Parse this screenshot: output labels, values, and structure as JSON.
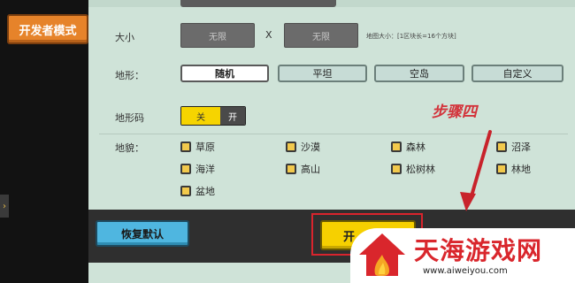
{
  "sidebar": {
    "dev_mode_label": "开发者模式",
    "expand_icon": "chevron-right-icon"
  },
  "form": {
    "size": {
      "label": "大小",
      "width_value": "无限",
      "x_label": "X",
      "height_value": "无限",
      "hint": "地图大小：[1区块长=16个方块]"
    },
    "terrain": {
      "label": "地形：",
      "options": [
        "随机",
        "平坦",
        "空岛",
        "自定义"
      ],
      "selected": "随机"
    },
    "terrain_code": {
      "label": "地形码",
      "off_label": "关",
      "on_label": "开",
      "selected": "关"
    },
    "biomes": {
      "label": "地貌：",
      "items": [
        "草原",
        "沙漠",
        "森林",
        "沼泽",
        "海洋",
        "高山",
        "松树林",
        "林地",
        "盆地"
      ]
    }
  },
  "footer": {
    "reset_label": "恢复默认",
    "start_label": "开"
  },
  "annotation": {
    "step_label": "步骤四",
    "color": "#d3323a"
  },
  "watermark": {
    "title": "天海游戏网",
    "url": "www.aiweiyou.com"
  },
  "colors": {
    "panel_bg": "#cfe3d8",
    "accent_orange": "#e6832a",
    "toggle_yellow": "#f6d400",
    "reset_blue": "#4fb6e0",
    "start_yellow": "#f6d000",
    "highlight_red": "#d8242d"
  }
}
